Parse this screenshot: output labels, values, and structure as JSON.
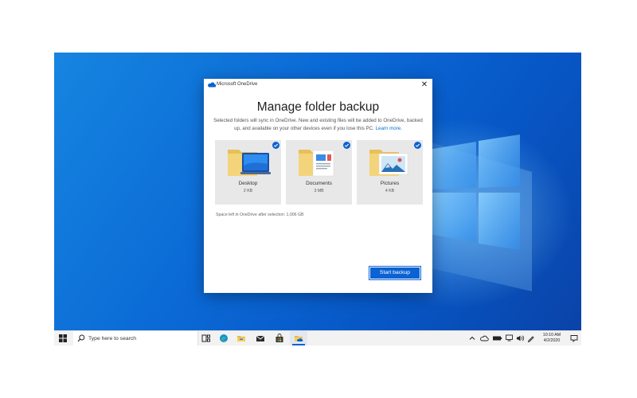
{
  "dialog": {
    "app_title": "Microsoft OneDrive",
    "close_glyph": "✕",
    "heading": "Manage folder backup",
    "description": "Selected folders will sync in OneDrive. New and existing files will be added to OneDrive, backed up, and available on your other devices even if you lose this PC.",
    "learn_more": "Learn more.",
    "folders": [
      {
        "name": "Desktop",
        "size": "2 KB",
        "selected": true,
        "icon": "desktop-folder-icon"
      },
      {
        "name": "Documents",
        "size": "3 MB",
        "selected": true,
        "icon": "documents-folder-icon"
      },
      {
        "name": "Pictures",
        "size": "4 KB",
        "selected": true,
        "icon": "pictures-folder-icon"
      }
    ],
    "space_left": "Space left in OneDrive after selection: 1,006 GB",
    "start_button": "Start backup"
  },
  "taskbar": {
    "search_placeholder": "Type here to search",
    "apps": [
      "task-view-icon",
      "edge-icon",
      "file-explorer-icon",
      "mail-icon",
      "store-icon",
      "onedrive-setup-icon"
    ],
    "tray_icons": [
      "chevron-up-icon",
      "onedrive-cloud-icon",
      "battery-icon",
      "network-icon",
      "volume-icon",
      "pen-icon"
    ],
    "time": "10:10 AM",
    "date": "4/2/2020"
  },
  "colors": {
    "accent": "#0b62d3",
    "desktop_blue": "#0b6ad6",
    "taskbar": "#f2f2f2"
  }
}
